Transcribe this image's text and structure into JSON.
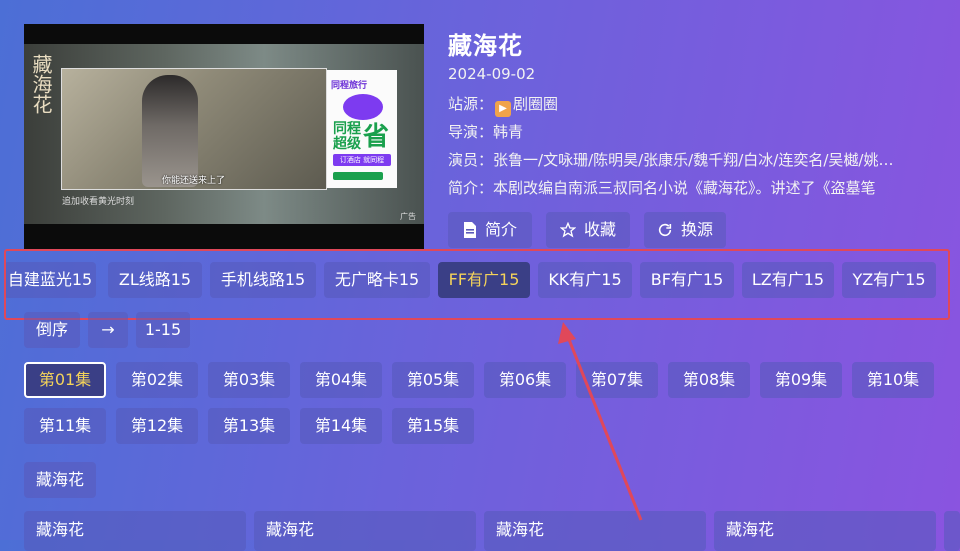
{
  "player": {
    "vertical_logo": "藏海花",
    "subtitle": "你能还送来上了",
    "caption": "追加收看黄光时刻",
    "ad_tag": "广告",
    "ad": {
      "brand": "同程旅行",
      "big1": "同程",
      "big2": "省",
      "big3": "超级",
      "pill": "订酒店 就同程"
    }
  },
  "info": {
    "title": "藏海花",
    "date": "2024-09-02",
    "station_label": "站源：",
    "station_value": "剧圈圈",
    "director_label": "导演：",
    "director_value": "韩青",
    "cast_label": "演员：",
    "cast_value": "张鲁一/文咏珊/陈明昊/张康乐/魏千翔/白冰/连奕名/吴樾/姚…",
    "intro_label": "简介：",
    "intro_value": "本剧改编自南派三叔同名小说《藏海花》。讲述了《盗墓笔"
  },
  "actions": {
    "intro": "简介",
    "favorite": "收藏",
    "switch_source": "换源"
  },
  "lines": [
    "自建蓝光15",
    "ZL线路15",
    "手机线路15",
    "无广略卡15",
    "FF有广15",
    "KK有广15",
    "BF有广15",
    "LZ有广15",
    "YZ有广15"
  ],
  "active_line": "FF有广15",
  "controls": {
    "reverse": "倒序",
    "arrow": "→",
    "range": "1-15"
  },
  "episodes": [
    "第01集",
    "第02集",
    "第03集",
    "第04集",
    "第05集",
    "第06集",
    "第07集",
    "第08集",
    "第09集",
    "第10集",
    "第11集",
    "第12集",
    "第13集",
    "第14集",
    "第15集"
  ],
  "active_episode": "第01集",
  "related": {
    "header": "藏海花",
    "cards": [
      "藏海花",
      "藏海花",
      "藏海花",
      "藏海花"
    ]
  },
  "colors": {
    "accent_yellow": "#f4d35a",
    "highlight_red": "#e0485a",
    "bg_start": "#4c6fd6",
    "bg_end": "#8a54e0"
  }
}
